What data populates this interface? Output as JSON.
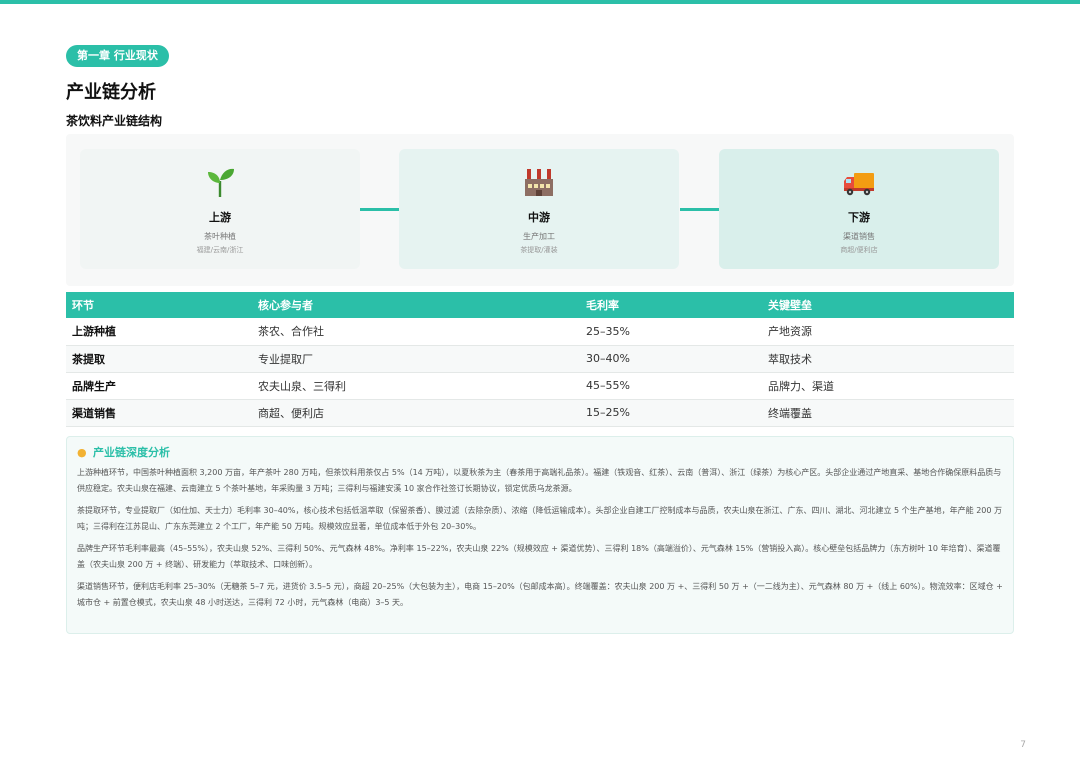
{
  "chapter_badge": "第一章 行业现状",
  "page_title": "产业链分析",
  "section_title": "茶饮料产业链结构",
  "chain": [
    {
      "icon": "seedling-icon",
      "name": "上游",
      "desc": "茶叶种植",
      "sub": "福建/云南/浙江"
    },
    {
      "icon": "factory-icon",
      "name": "中游",
      "desc": "生产加工",
      "sub": "茶提取/灌装"
    },
    {
      "icon": "delivery-truck-icon",
      "name": "下游",
      "desc": "渠道销售",
      "sub": "商超/便利店"
    }
  ],
  "table": {
    "headers": [
      "环节",
      "核心参与者",
      "毛利率",
      "关键壁垒"
    ],
    "rows": [
      [
        "上游种植",
        "茶农、合作社",
        "25–35%",
        "产地资源"
      ],
      [
        "茶提取",
        "专业提取厂",
        "30–40%",
        "萃取技术"
      ],
      [
        "品牌生产",
        "农夫山泉、三得利",
        "45–55%",
        "品牌力、渠道"
      ],
      [
        "渠道销售",
        "商超、便利店",
        "15–25%",
        "终端覆盖"
      ]
    ]
  },
  "analysis": {
    "title": "产业链深度分析",
    "paragraphs": [
      "上游种植环节，中国茶叶种植面积 3,200 万亩，年产茶叶 280 万吨，但茶饮料用茶仅占 5%（14 万吨），以夏秋茶为主（春茶用于高端礼品茶）。福建（铁观音、红茶）、云南（普洱）、浙江（绿茶）为核心产区。头部企业通过产地直采、基地合作确保原料品质与供应稳定。农夫山泉在福建、云南建立 5 个茶叶基地，年采购量 3 万吨；三得利与福建安溪 10 家合作社签订长期协议，锁定优质乌龙茶源。",
      "茶提取环节，专业提取厂（如仕加、天士力）毛利率 30–40%，核心技术包括低温萃取（保留茶香）、膜过滤（去除杂质）、浓缩（降低运输成本）。头部企业自建工厂控制成本与品质，农夫山泉在浙江、广东、四川、湖北、河北建立 5 个生产基地，年产能 200 万吨；三得利在江苏昆山、广东东莞建立 2 个工厂，年产能 50 万吨。规模效应显著，单位成本低于外包 20–30%。",
      "品牌生产环节毛利率最高（45–55%），农夫山泉 52%、三得利 50%、元气森林 48%。净利率 15–22%，农夫山泉 22%（规模效应 + 渠道优势）、三得利 18%（高端溢价）、元气森林 15%（营销投入高）。核心壁垒包括品牌力（东方树叶 10 年培育）、渠道覆盖（农夫山泉 200 万 + 终端）、研发能力（萃取技术、口味创新）。",
      "渠道销售环节，便利店毛利率 25–30%（无糖茶 5–7 元，进货价 3.5–5 元），商超 20–25%（大包装为主），电商 15–20%（包邮成本高）。终端覆盖：农夫山泉 200 万 +、三得利 50 万 +（一二线为主）、元气森林 80 万 +（线上 60%）。物流效率：区域仓 + 城市仓 + 前置仓模式，农夫山泉 48 小时送达，三得利 72 小时，元气森林（电商）3–5 天。"
    ]
  },
  "page_number": "7",
  "colors": {
    "accent": "#2bbfa8"
  }
}
